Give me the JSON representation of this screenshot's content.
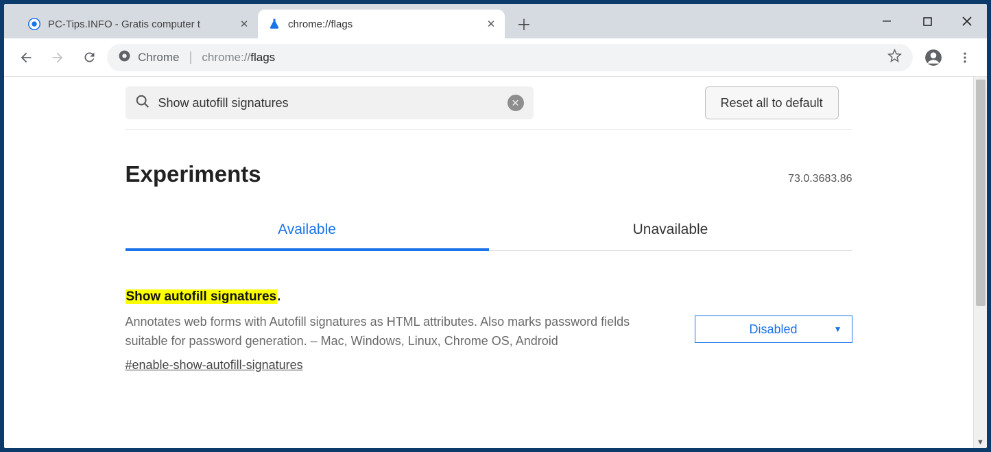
{
  "window": {
    "tabs": [
      {
        "title": "PC-Tips.INFO - Gratis computer t",
        "active": false
      },
      {
        "title": "chrome://flags",
        "active": true
      }
    ]
  },
  "omnibox": {
    "label": "Chrome",
    "url_prefix": "chrome://",
    "url_path": "flags"
  },
  "flags": {
    "search_value": "Show autofill signatures",
    "reset_label": "Reset all to default",
    "heading": "Experiments",
    "version": "73.0.3683.86",
    "tabs": {
      "available": "Available",
      "unavailable": "Unavailable"
    },
    "item": {
      "title_highlight": "Show autofill signatures",
      "title_suffix": ".",
      "description": "Annotates web forms with Autofill signatures as HTML attributes. Also marks password fields suitable for password generation. – Mac, Windows, Linux, Chrome OS, Android",
      "anchor": "#enable-show-autofill-signatures",
      "select_value": "Disabled"
    }
  }
}
